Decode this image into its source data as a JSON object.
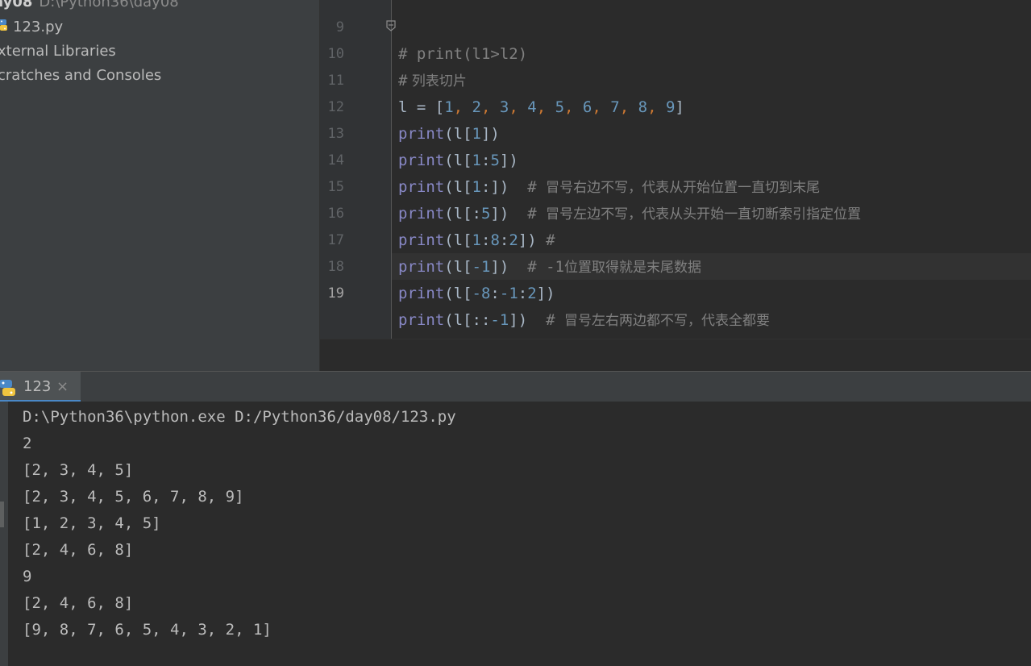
{
  "project": {
    "root_name": "ay08",
    "root_path": "D:\\Python36\\day08",
    "file": "123.py",
    "external_libraries": "xternal Libraries",
    "scratches": "cratches and Consoles"
  },
  "editor": {
    "lines": [
      {
        "n": "9"
      },
      {
        "n": "10"
      },
      {
        "n": "11"
      },
      {
        "n": "12"
      },
      {
        "n": "13"
      },
      {
        "n": "14"
      },
      {
        "n": "15"
      },
      {
        "n": "16"
      },
      {
        "n": "17"
      },
      {
        "n": "18"
      },
      {
        "n": "19"
      }
    ],
    "code": {
      "l9": "# print(l1>l2)",
      "l10_hash": "#",
      "l10_text": " 列表切片",
      "l11": {
        "a": "l = [",
        "n1": "1",
        "n2": "2",
        "n3": "3",
        "n4": "4",
        "n5": "5",
        "n6": "6",
        "n7": "7",
        "n8": "8",
        "n9": "9",
        "close": "]",
        "sep": ", "
      },
      "print_kw": "print",
      "l12": {
        "a": "(l[",
        "n": "1",
        "b": "])"
      },
      "l13": {
        "a": "(l[",
        "n1": "1",
        "c": ":",
        "n2": "5",
        "b": "])"
      },
      "l14": {
        "a": "(l[",
        "n1": "1",
        "b": ":])",
        "hash": "  # ",
        "cmt": "冒号右边不写，代表从开始位置一直切到末尾"
      },
      "l15": {
        "a": "(l[:",
        "n": "5",
        "b": "])",
        "hash": "  # ",
        "cmt": "冒号左边不写，代表从头开始一直切断索引指定位置"
      },
      "l16": {
        "a": "(l[",
        "n1": "1",
        "c1": ":",
        "n2": "8",
        "c2": ":",
        "n3": "2",
        "b": "])",
        "hash": " #"
      },
      "l17": {
        "a": "(l[",
        "n": "-1",
        "b": "])",
        "hash": "  # -1",
        "cmt": "位置取得就是末尾数据"
      },
      "l18": {
        "a": "(l[",
        "n1": "-8",
        "c1": ":",
        "n2": "-1",
        "c2": ":",
        "n3": "2",
        "b": "])"
      },
      "l19": {
        "a": "(l[::",
        "n": "-1",
        "b": "])",
        "hash": "  # ",
        "cmt": "冒号左右两边都不写，代表全都要"
      }
    }
  },
  "run": {
    "tab_label": "123",
    "tab_close": "×",
    "output": [
      "D:\\Python36\\python.exe D:/Python36/day08/123.py",
      "2",
      "[2, 3, 4, 5]",
      "[2, 3, 4, 5, 6, 7, 8, 9]",
      "[1, 2, 3, 4, 5]",
      "[2, 4, 6, 8]",
      "9",
      "[2, 4, 6, 8]",
      "[9, 8, 7, 6, 5, 4, 3, 2, 1]"
    ]
  },
  "colors": {
    "keyword": "#8888c6",
    "number": "#6897bb",
    "comma": "#cc7832",
    "comment": "#808080",
    "text": "#a9b7c6"
  },
  "icons": {
    "python_file": "python-icon",
    "fold": "fold-marker-icon",
    "close": "close-icon"
  }
}
